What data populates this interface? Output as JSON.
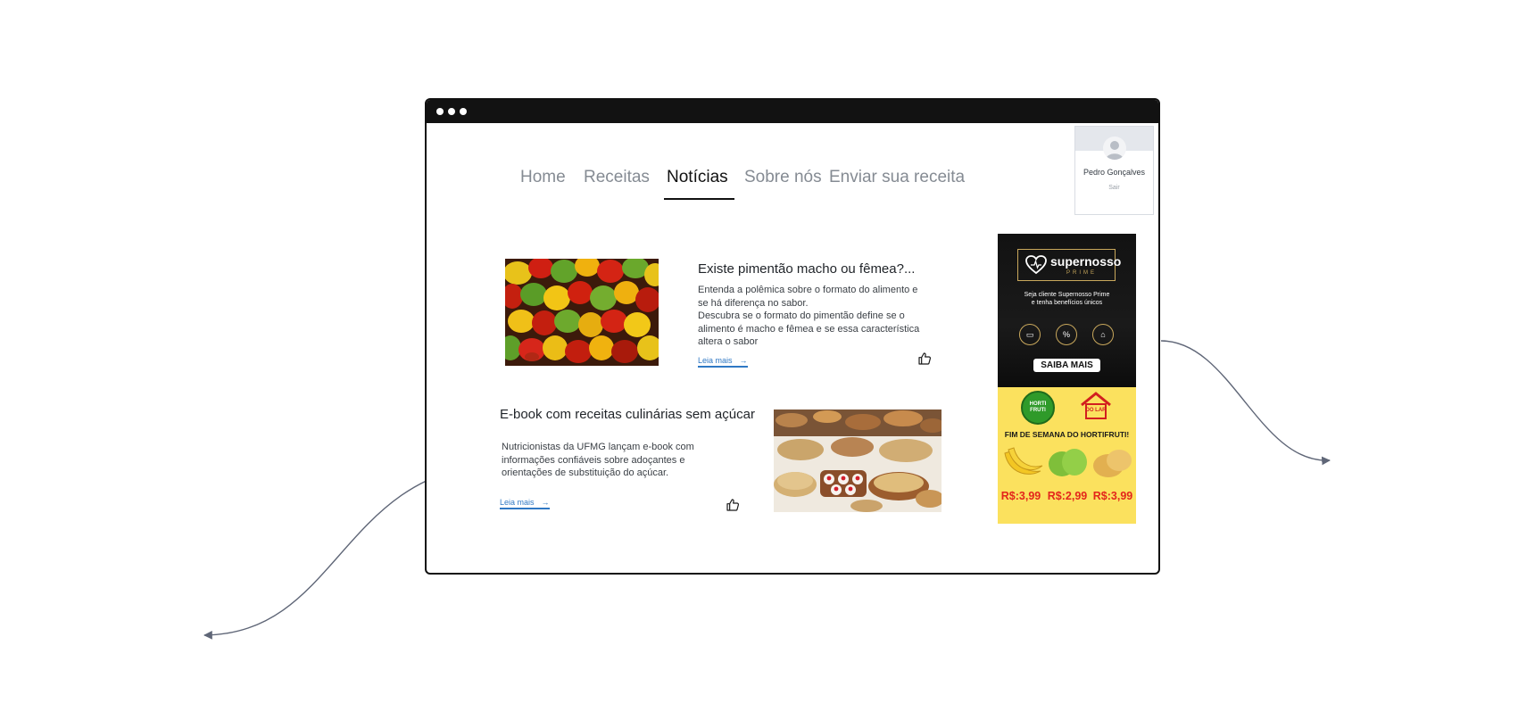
{
  "nav": {
    "items": [
      {
        "label": "Home"
      },
      {
        "label": "Receitas"
      },
      {
        "label": "Notícias"
      },
      {
        "label": "Sobre nós"
      },
      {
        "label": "Enviar sua receita"
      }
    ],
    "active": "Notícias"
  },
  "user": {
    "name": "Pedro Gonçalves",
    "logout_label": "Sair"
  },
  "articles": [
    {
      "title": "Existe pimentão macho ou fêmea?...",
      "description_lines": [
        "Entenda a polêmica sobre o formato do alimento e",
        "se há diferença no sabor.",
        "Descubra se o formato do pimentão define se o",
        "alimento é macho e fêmea e se essa característica",
        "altera o sabor"
      ],
      "read_more": "Leia mais"
    },
    {
      "title": "E-book com receitas culinárias sem açúcar",
      "description_lines": [
        "Nutricionistas da UFMG lançam e-book com",
        "informações confiáveis sobre adoçantes e",
        "orientações de substituição do açúcar."
      ],
      "read_more": "Leia mais"
    }
  ],
  "ad": {
    "brand": "supernosso",
    "brand_sub": "PRIME",
    "tagline_lines": [
      "Seja cliente Supernosso Prime",
      "e tenha benefícios únicos"
    ],
    "cta": "SAIBA MAIS",
    "badge_hortifruti": "HORTI FRUTI",
    "badge_store": "DO LAR",
    "headline": "FIM DE SEMANA DO HORTIFRUTI!",
    "prices": [
      "R$:3,99",
      "R$:2,99",
      "R$:3,99"
    ]
  },
  "colors": {
    "nav_inactive": "#858b93",
    "nav_active": "#111111",
    "link": "#2f78c4",
    "ad_dark": "#121212",
    "ad_yellow": "#fbe15e",
    "ad_price": "#e3261b",
    "connector": "#5f6677"
  }
}
